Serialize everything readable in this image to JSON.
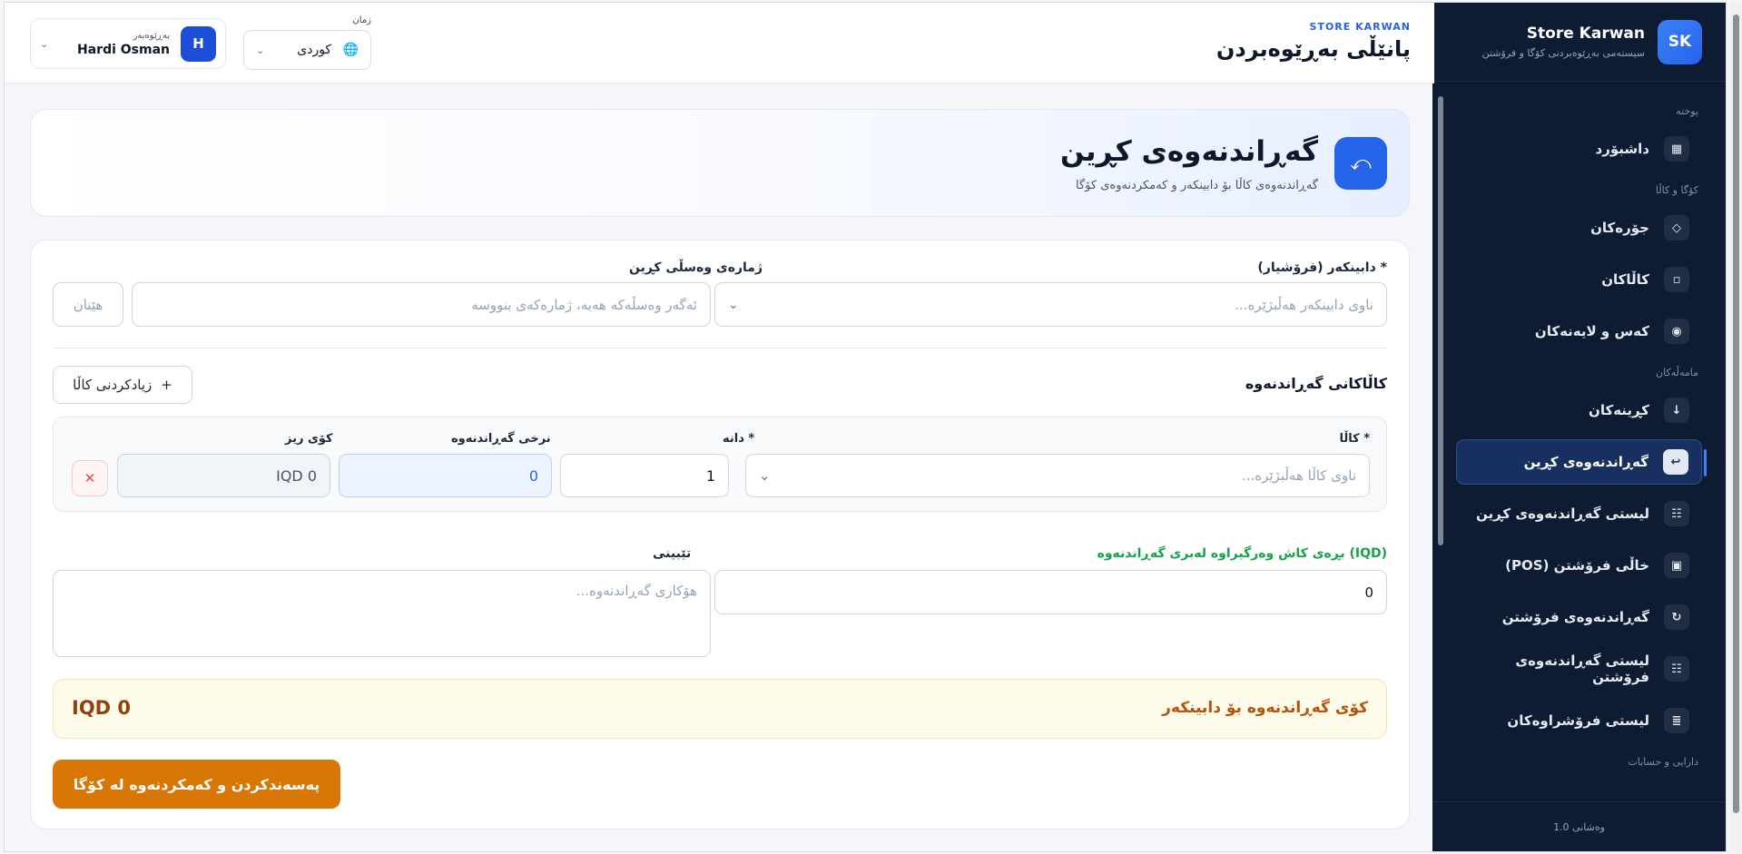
{
  "sidebar": {
    "logo_text": "SK",
    "title": "Store Karwan",
    "subtitle": "سیستەمی بەڕێوەبردنی کۆگا و فرۆشتن",
    "sections": {
      "general": "پوختە",
      "warehouse": "کۆگا و کاڵا",
      "transactions": "مامەڵەکان",
      "finance": "دارایی و حسابات"
    },
    "items": [
      {
        "label": "داشبۆرد",
        "icon": "grid-icon"
      },
      {
        "label": "جۆرەکان",
        "icon": "diamond-icon"
      },
      {
        "label": "کاڵاکان",
        "icon": "box-icon"
      },
      {
        "label": "کەس و لایەنەکان",
        "icon": "person-icon"
      },
      {
        "label": "کڕینەکان",
        "icon": "arrow-down-icon"
      },
      {
        "label": "گەڕاندنەوەی کڕین",
        "icon": "return-icon"
      },
      {
        "label": "لیستی گەڕاندنەوەی کڕین",
        "icon": "list-icon"
      },
      {
        "label": "خاڵی فرۆشتن (POS)",
        "icon": "pos-icon"
      },
      {
        "label": "گەڕاندنەوەی فرۆشتن",
        "icon": "refresh-icon"
      },
      {
        "label": "لیستی گەڕاندنەوەی فرۆشتن",
        "icon": "list-icon"
      },
      {
        "label": "لیستی فرۆشراوەکان",
        "icon": "lines-icon"
      }
    ],
    "version": "وەشانی 1.0"
  },
  "header": {
    "eyebrow": "STORE KARWAN",
    "title": "پانێڵی بەڕێوەبردن",
    "language_label": "زمان",
    "language_value": "کوردی",
    "user_role": "بەڕێوەبەر",
    "user_name": "Hardi Osman",
    "user_initial": "H"
  },
  "hero": {
    "title": "گەڕاندنەوەی کڕین",
    "subtitle": "گەڕاندنەوەی کاڵا بۆ دابینکەر و کەمکردنەوەی کۆگا"
  },
  "form": {
    "supplier_label": "دابینکەر (فرۆشیار) *",
    "supplier_placeholder": "ناوی دابینکەر هەڵبژێرە...",
    "invoice_label": "ژمارەی وەسڵی کڕین",
    "invoice_placeholder": "ئەگەر وەسڵەکە هەیە، ژمارەکەی بنووسە",
    "fetch_label": "هێنان",
    "items_title": "کاڵاکانی گەڕاندنەوە",
    "add_item_label": "زیادکردنی کاڵا",
    "item_row": {
      "product_label": "کاڵا *",
      "product_placeholder": "ناوی کاڵا هەڵبژێرە...",
      "qty_label": "دانە *",
      "qty_value": "1",
      "price_label": "نرخی گەڕاندنەوە",
      "price_value": "0",
      "total_label": "کۆی ریز",
      "total_value": "IQD 0"
    },
    "cash_label": "بڕەی کاش وەرگیراوە لەبری گەڕاندنەوە (IQD)",
    "cash_value": "0",
    "note_label": "تێبینی",
    "note_placeholder": "هۆکاری گەڕاندنەوە...",
    "total_label": "کۆی گەڕاندنەوە بۆ دابینکەر",
    "total_value": "IQD 0",
    "submit_label": "پەسەندکردن و کەمکردنەوە لە کۆگا"
  }
}
